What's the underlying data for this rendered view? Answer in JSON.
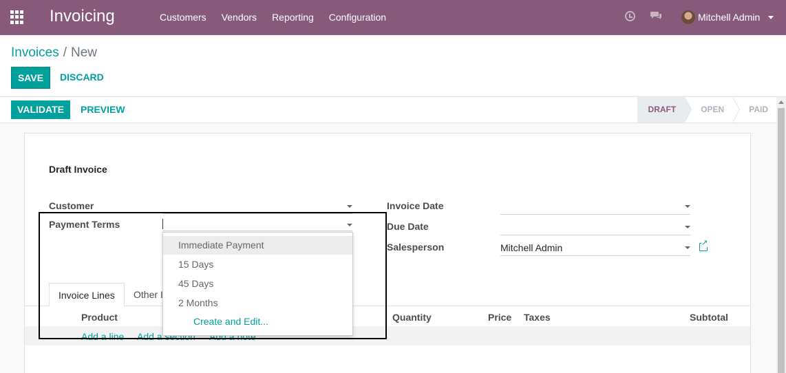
{
  "navbar": {
    "app_name": "Invoicing",
    "menu": [
      "Customers",
      "Vendors",
      "Reporting",
      "Configuration"
    ],
    "user_name": "Mitchell Admin",
    "icons": [
      "apps-icon",
      "clock-icon",
      "chat-icon",
      "avatar",
      "caret-down-icon"
    ],
    "background_color": "#875a7b"
  },
  "breadcrumb": {
    "parent": "Invoices",
    "separator": "/",
    "current": "New"
  },
  "control": {
    "save_label": "SAVE",
    "discard_label": "DISCARD"
  },
  "statusbar": {
    "validate_label": "VALIDATE",
    "preview_label": "PREVIEW",
    "steps": [
      "DRAFT",
      "OPEN",
      "PAID"
    ],
    "active_step": "DRAFT"
  },
  "form": {
    "title": "Draft Invoice",
    "customer_label": "Customer",
    "customer_value": "",
    "payment_terms_label": "Payment Terms",
    "payment_terms_value": "",
    "invoice_date_label": "Invoice Date",
    "invoice_date_value": "",
    "due_date_label": "Due Date",
    "due_date_value": "",
    "salesperson_label": "Salesperson",
    "salesperson_value": "Mitchell Admin"
  },
  "tabs": {
    "invoice_lines": "Invoice Lines",
    "other_info": "Other I"
  },
  "table": {
    "headers": {
      "product": "Product",
      "quantity": "Quantity",
      "price": "Price",
      "taxes": "Taxes",
      "subtotal": "Subtotal"
    },
    "add_line": "Add a line",
    "add_section": "Add a section",
    "add_note": "Add a note"
  },
  "dropdown": {
    "options": [
      "Immediate Payment",
      "15 Days",
      "45 Days",
      "2 Months"
    ],
    "highlighted": "Immediate Payment",
    "create_label": "Create and Edit..."
  },
  "accent_color": "#00a09d"
}
